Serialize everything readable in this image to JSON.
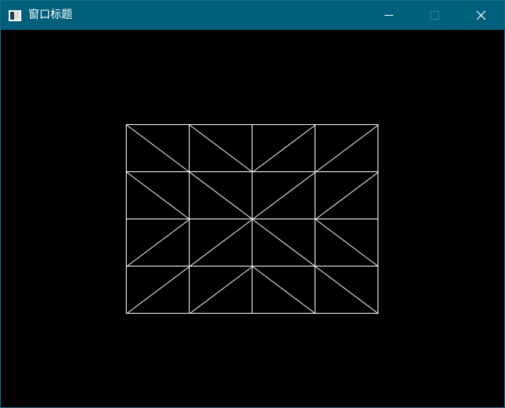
{
  "window": {
    "title": "窗口标题",
    "app_icon": "window-app-icon",
    "controls": {
      "minimize_icon": "minimize-icon",
      "maximize_icon": "maximize-icon",
      "close_icon": "close-icon"
    },
    "colors": {
      "titlebar": "#005f7b",
      "client_background": "#000000",
      "line": "#ffffff"
    }
  }
}
